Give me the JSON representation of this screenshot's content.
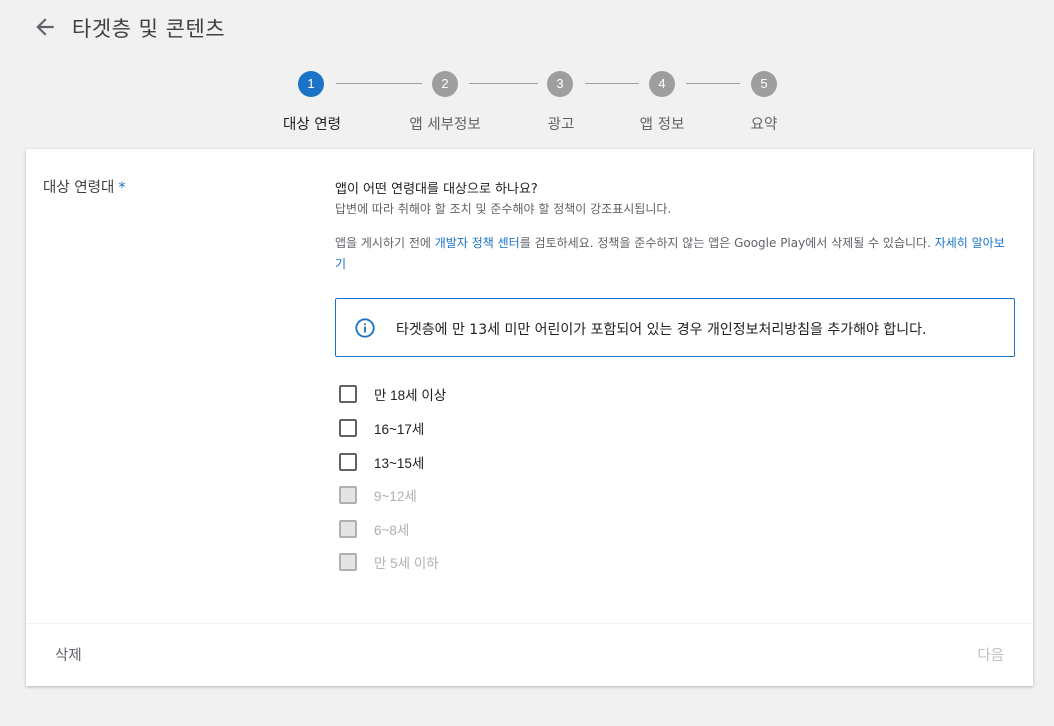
{
  "header": {
    "title": "타겟층 및 콘텐츠",
    "back_icon": "arrow-left-icon"
  },
  "stepper": {
    "steps": [
      {
        "number": "1",
        "label": "대상 연령",
        "active": true
      },
      {
        "number": "2",
        "label": "앱 세부정보",
        "active": false
      },
      {
        "number": "3",
        "label": "광고",
        "active": false
      },
      {
        "number": "4",
        "label": "앱 정보",
        "active": false
      },
      {
        "number": "5",
        "label": "요약",
        "active": false
      }
    ],
    "colors": {
      "active": "#1a73c6",
      "inactive": "#9e9e9e"
    }
  },
  "form": {
    "field_label": "대상 연령대",
    "required_mark": "*",
    "question": "앱이 어떤 연령대를 대상으로 하나요?",
    "subtext": "답변에 따라 취해야 할 조치 및 준수해야 할 정책이 강조표시됩니다.",
    "policy_text_1": "앱을 게시하기 전에 ",
    "policy_link_1": "개발자 정책 센터",
    "policy_text_2": "를 검토하세요. 정책을 준수하지 않는 앱은 Google Play에서 삭제될 수 있습니다. ",
    "policy_link_2": "자세히 알아보기",
    "info_icon": "info-icon",
    "info_text": "타겟층에 만 13세 미만 어린이가 포함되어 있는 경우 개인정보처리방침을 추가해야 합니다.",
    "options": [
      {
        "label": "만 18세 이상",
        "checked": false,
        "disabled": false
      },
      {
        "label": "16~17세",
        "checked": false,
        "disabled": false
      },
      {
        "label": "13~15세",
        "checked": false,
        "disabled": false
      },
      {
        "label": "9~12세",
        "checked": false,
        "disabled": true
      },
      {
        "label": "6~8세",
        "checked": false,
        "disabled": true
      },
      {
        "label": "만 5세 이하",
        "checked": false,
        "disabled": true
      }
    ]
  },
  "footer": {
    "delete_label": "삭제",
    "next_label": "다음",
    "next_enabled": false
  }
}
